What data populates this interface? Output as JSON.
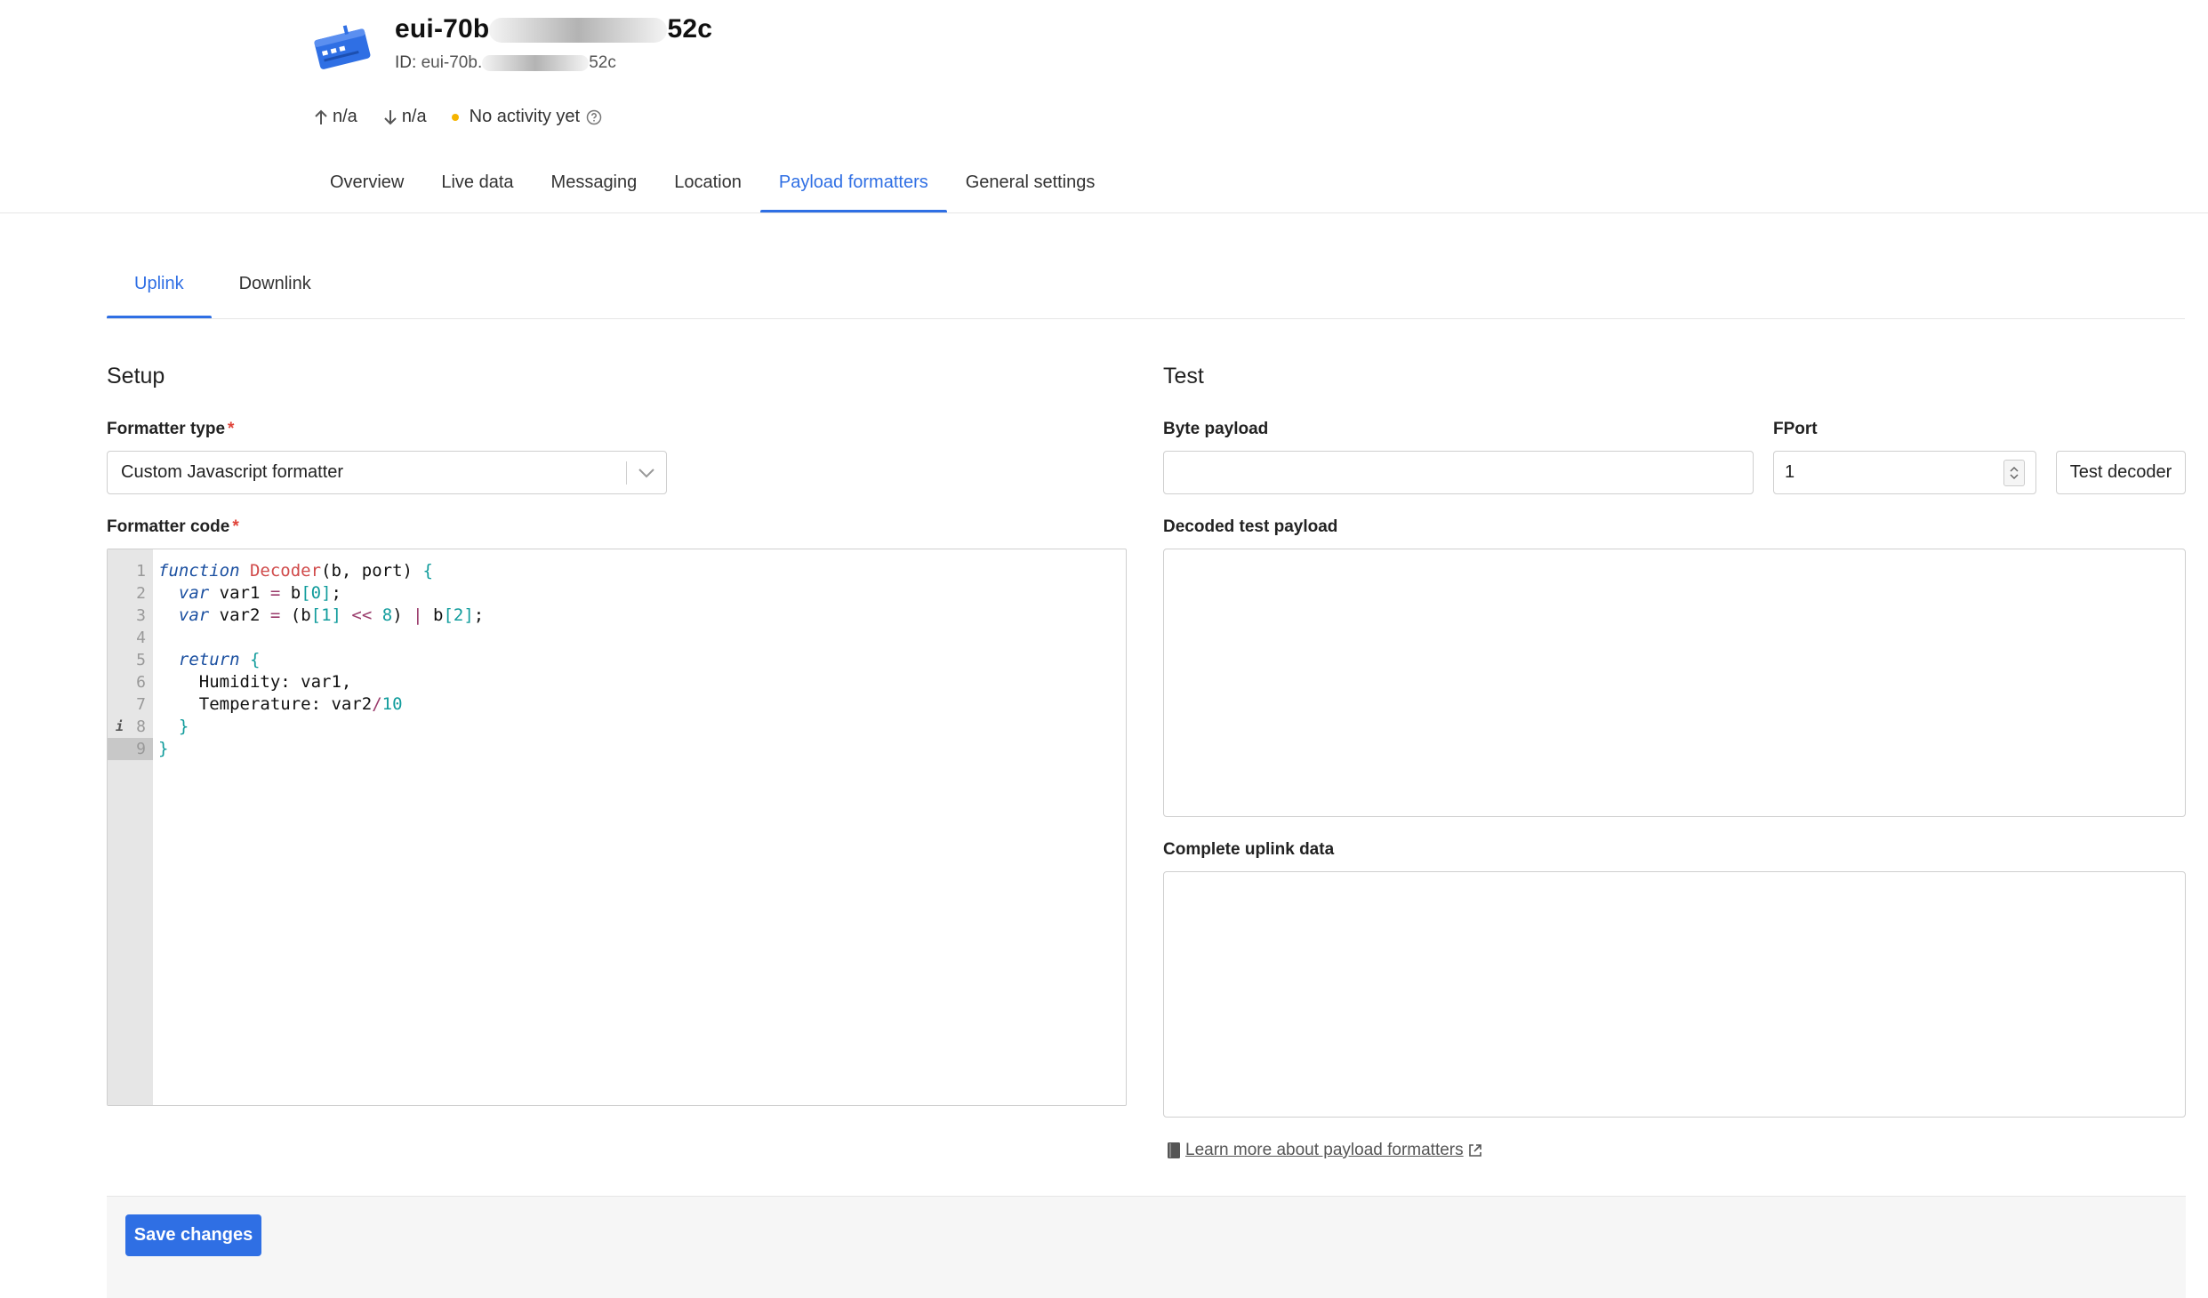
{
  "device": {
    "title_prefix": "eui-70b",
    "title_suffix": "52c",
    "id_label": "ID:",
    "id_prefix": "eui-70b.",
    "id_suffix": "52c",
    "icon": "gateway-device-icon"
  },
  "stats": {
    "uplink": "n/a",
    "downlink": "n/a",
    "activity": "No activity yet",
    "activity_color": "#f5b400"
  },
  "main_tabs": [
    {
      "label": "Overview"
    },
    {
      "label": "Live data"
    },
    {
      "label": "Messaging"
    },
    {
      "label": "Location"
    },
    {
      "label": "Payload formatters",
      "active": true
    },
    {
      "label": "General settings"
    }
  ],
  "sub_tabs": [
    {
      "label": "Uplink",
      "active": true
    },
    {
      "label": "Downlink"
    }
  ],
  "setup": {
    "title": "Setup",
    "formatter_type_label": "Formatter type",
    "formatter_type_value": "Custom Javascript formatter",
    "formatter_code_label": "Formatter code",
    "line_numbers": [
      "1",
      "2",
      "3",
      "4",
      "5",
      "6",
      "7",
      "8",
      "9"
    ],
    "code_lines": [
      "function Decoder(b, port) {",
      "  var var1 = b[0];",
      "  var var2 = (b[1] << 8) | b[2];",
      "",
      "  return {",
      "    Humidity: var1,",
      "    Temperature: var2/10",
      "  }",
      "}"
    ]
  },
  "test": {
    "title": "Test",
    "byte_payload_label": "Byte payload",
    "byte_payload_value": "",
    "fport_label": "FPort",
    "fport_value": "1",
    "test_button": "Test decoder",
    "decoded_label": "Decoded test payload",
    "complete_label": "Complete uplink data",
    "learn_more": "Learn more about payload formatters"
  },
  "footer": {
    "save_label": "Save changes"
  },
  "colors": {
    "accent": "#2f6fe4",
    "required": "#e0443a"
  }
}
